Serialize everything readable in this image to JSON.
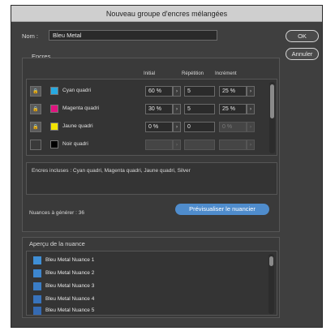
{
  "window": {
    "title": "Nouveau groupe d'encres mélangées"
  },
  "name_label": "Nom :",
  "name_value": "Bleu Metal",
  "buttons": {
    "ok": "OK",
    "cancel": "Annuler"
  },
  "inks_section": {
    "title": "Encres",
    "col_initial": "Initial",
    "col_repetition": "Répétition",
    "col_increment": "Incrément",
    "rows": [
      {
        "name": "Cyan quadri",
        "color": "#27a9e1",
        "initial": "60 %",
        "repetition": "5",
        "increment": "25 %",
        "enabled": true
      },
      {
        "name": "Magenta quadri",
        "color": "#e0147f",
        "initial": "30 %",
        "repetition": "5",
        "increment": "25 %",
        "enabled": true
      },
      {
        "name": "Jaune quadri",
        "color": "#f2e300",
        "initial": "0 %",
        "repetition": "0",
        "increment": "0 %",
        "enabled": true
      },
      {
        "name": "Noir quadri",
        "color": "#000000",
        "initial": "",
        "repetition": "",
        "increment": "",
        "enabled": false
      }
    ],
    "included_inks": "Encres incluses : Cyan quadri, Magenta quadri, Jaune quadri, Silver",
    "shades_to_generate": "Nuances à générer : 36",
    "preview_button": "Prévisualiser le nuancier"
  },
  "preview_section": {
    "title": "Aperçu de la nuance",
    "items": [
      {
        "name": "Bleu Metal Nuance 1",
        "color": "#3f8fd6"
      },
      {
        "name": "Bleu Metal Nuance 2",
        "color": "#3d86cf"
      },
      {
        "name": "Bleu Metal Nuance 3",
        "color": "#3a7dc6"
      },
      {
        "name": "Bleu Metal Nuance 4",
        "color": "#3873bc"
      },
      {
        "name": "Bleu Metal Nuance 5",
        "color": "#356ab2"
      }
    ]
  },
  "icons": {
    "lock": "lock-icon",
    "arrow": "chevron-right-icon"
  },
  "colors": {
    "accent": "#4f8ccc",
    "dialog_bg": "#3f3f3f"
  }
}
